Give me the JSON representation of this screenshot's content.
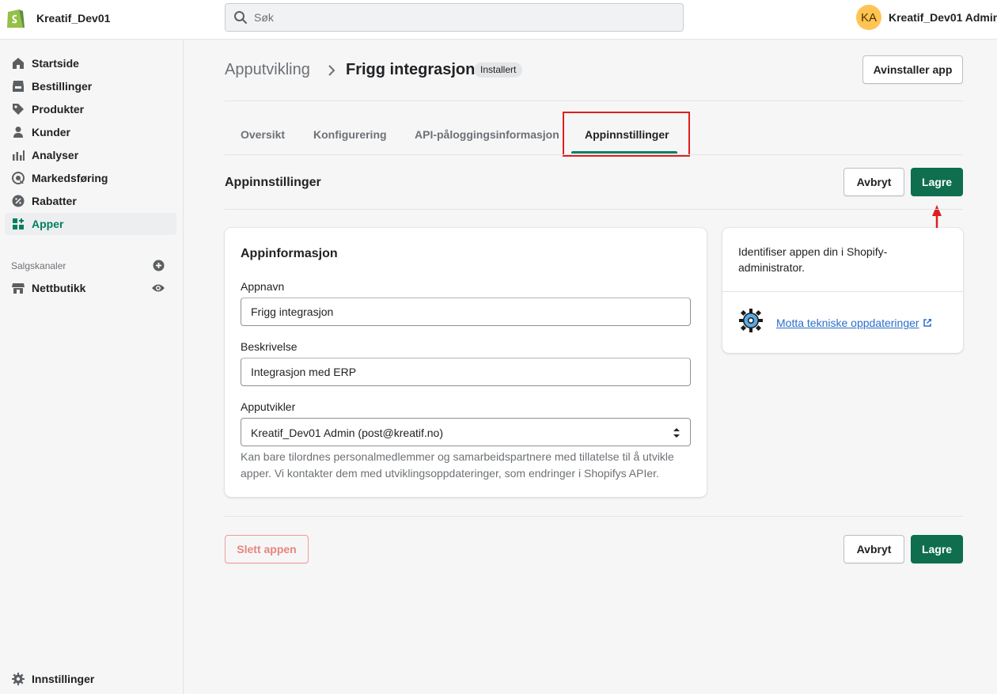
{
  "topbar": {
    "store_name": "Kreatif_Dev01",
    "search_placeholder": "Søk",
    "avatar_initials": "KA",
    "user_name": "Kreatif_Dev01 Admin"
  },
  "sidebar": {
    "items": [
      {
        "label": "Startside",
        "icon": "home-icon"
      },
      {
        "label": "Bestillinger",
        "icon": "orders-icon"
      },
      {
        "label": "Produkter",
        "icon": "tag-icon"
      },
      {
        "label": "Kunder",
        "icon": "person-icon"
      },
      {
        "label": "Analyser",
        "icon": "bar-chart-icon"
      },
      {
        "label": "Markedsføring",
        "icon": "target-icon"
      },
      {
        "label": "Rabatter",
        "icon": "discount-icon"
      },
      {
        "label": "Apper",
        "icon": "apps-icon",
        "active": true
      }
    ],
    "channels_label": "Salgskanaler",
    "channel_item": "Nettbutikk",
    "settings_label": "Innstillinger"
  },
  "header": {
    "breadcrumb": "Apputvikling",
    "title": "Frigg integrasjon",
    "badge": "Installert",
    "uninstall_button": "Avinstaller app"
  },
  "tabs": [
    "Oversikt",
    "Konfigurering",
    "API-påloggingsinformasjon",
    "Appinnstillinger"
  ],
  "selected_tab": "Appinnstillinger",
  "section": {
    "title": "Appinnstillinger",
    "cancel_button": "Avbryt",
    "save_button": "Lagre"
  },
  "form": {
    "card_title": "Appinformasjon",
    "app_name_label": "Appnavn",
    "app_name_value": "Frigg integrasjon",
    "description_label": "Beskrivelse",
    "description_value": "Integrasjon med ERP",
    "developer_label": "Apputvikler",
    "developer_value": "Kreatif_Dev01 Admin (post@kreatif.no)",
    "developer_help": "Kan bare tilordnes personalmedlemmer og samarbeidspartnere med tillatelse til å utvikle apper. Vi kontakter dem med utviklingsoppdateringer, som endringer i Shopifys APIer."
  },
  "side_card": {
    "text": "Identifiser appen din i Shopify-administrator.",
    "link_text": "Motta tekniske oppdateringer"
  },
  "footer": {
    "delete_button": "Slett appen",
    "cancel_button": "Avbryt",
    "save_button": "Lagre"
  },
  "colors": {
    "primary": "#008060",
    "highlight": "#e01e1e",
    "link": "#2c6ecb",
    "danger": "#e8857d"
  }
}
